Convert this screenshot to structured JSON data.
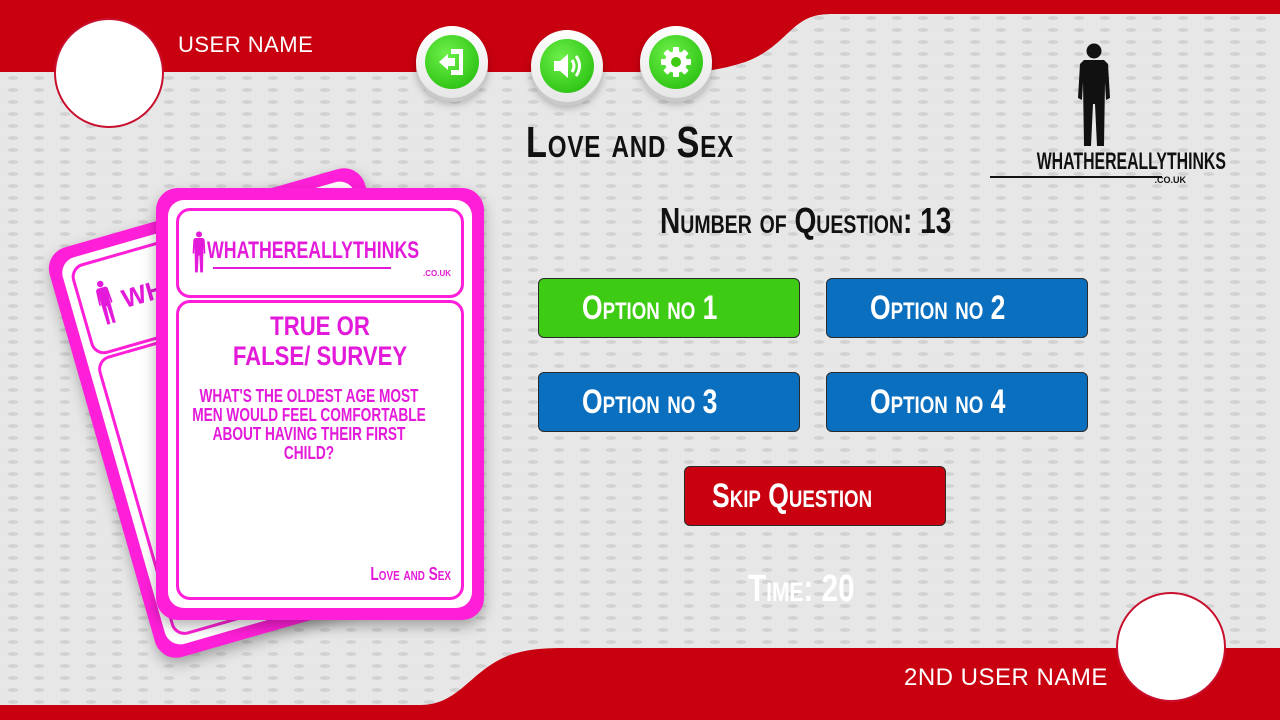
{
  "players": {
    "user1": {
      "name": "USER NAME"
    },
    "user2": {
      "name": "2ND USER NAME"
    }
  },
  "toolbar": {
    "exit_icon": "exit-door-icon",
    "sound_icon": "speaker-icon",
    "settings_icon": "gear-icon"
  },
  "game": {
    "category_title": "Love and Sex",
    "question_number_label": "Number of Question: 13",
    "options": [
      "Option no 1",
      "Option no 2",
      "Option no 3",
      "Option no 4"
    ],
    "skip_label": "Skip Question",
    "timer_label": "Time: 20"
  },
  "brand": {
    "name": "WHATHEREALLYTHINKS",
    "domain": ".CO.UK"
  },
  "card": {
    "brand_name": "WHATHEREALLYTHINKS",
    "brand_domain": ".CO.UK",
    "question_type": "TRUE OR FALSE/ SURVEY",
    "question_text": "WHAT'S THE OLDEST AGE MOST MEN WOULD FEEL COMFORTABLE ABOUT HAVING THEIR FIRST CHILD?",
    "category": "Love and Sex",
    "back_card_brand_fragment": "WH"
  },
  "colors": {
    "band_red": "#c8000f",
    "option_selected": "#3ecb14",
    "option_default": "#0b6fbf",
    "skip_button": "#c8000f",
    "card_magenta": "#ff1fd8"
  }
}
